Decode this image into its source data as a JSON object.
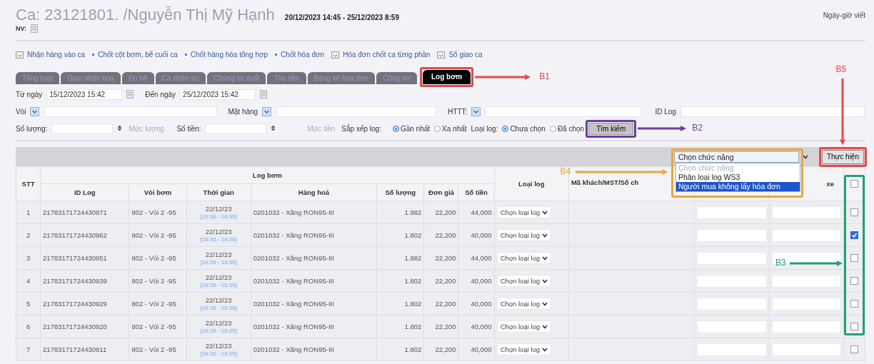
{
  "header": {
    "title": "Ca: 23121801. /Nguyễn Thị Mỹ Hạnh",
    "period": "20/12/2023 14:45 - 25/12/2023 8:59",
    "staff_label": "NV:",
    "right_label": "Ngày-giờ viết"
  },
  "links": [
    {
      "kind": "doc",
      "label": "Nhận hàng vào ca"
    },
    {
      "kind": "bullet",
      "label": "Chốt cột bơm, bể cuối ca"
    },
    {
      "kind": "bullet",
      "label": "Chốt hàng hóa tổng hợp"
    },
    {
      "kind": "bullet",
      "label": "Chốt hóa đơn"
    },
    {
      "kind": "doc",
      "label": "Hóa đơn chốt ca từng phần"
    },
    {
      "kind": "doc",
      "label": "Sổ giao ca"
    }
  ],
  "tabs": [
    {
      "label": "Tổng hợp",
      "selected": false
    },
    {
      "label": "Giao nhận hóa",
      "selected": false
    },
    {
      "label": "Đo bể",
      "selected": false
    },
    {
      "label": "Cá nhân sự",
      "selected": false
    },
    {
      "label": "Chứng từ xuất",
      "selected": false
    },
    {
      "label": "Thu tiền",
      "selected": false
    },
    {
      "label": "Bảng kê hóa đơn",
      "selected": false
    },
    {
      "label": "Công nợ",
      "selected": false
    },
    {
      "label": "Log bơm",
      "selected": true
    }
  ],
  "filters": {
    "from_label": "Từ ngày",
    "from_value": "15/12/2023 15:42",
    "to_label": "Đến ngày",
    "to_value": "25/12/2023 15:42",
    "nozzle_label": "Vòi",
    "product_label": "Mặt hàng",
    "payment_label": "HTTT:",
    "id_label": "ID Log",
    "qty_label": "Số lượng:",
    "qty_placeholder": "Mức lượng",
    "amount_label": "Số tiền:",
    "amount_placeholder": "Mức tiền",
    "sort_label": "Sắp xếp log:",
    "sort_options": [
      {
        "label": "Gần nhất",
        "selected": true
      },
      {
        "label": "Xa nhất",
        "selected": false
      }
    ],
    "type_label": "Loại log:",
    "type_options": [
      {
        "label": "Chưa chọn",
        "selected": true
      },
      {
        "label": "Đã chọn",
        "selected": false
      }
    ],
    "search_button": "Tìm kiếm"
  },
  "toolbar": {
    "function_value": "Chọn chức năng",
    "function_options": [
      {
        "label": "Chọn chức năng",
        "disabled": true,
        "selected": false
      },
      {
        "label": "Phân loại log WS3",
        "disabled": false,
        "selected": false
      },
      {
        "label": "Người mua không lấy hóa đơn",
        "disabled": false,
        "selected": true
      }
    ],
    "run_button": "Thực hiện"
  },
  "table": {
    "select_all_checked": false,
    "stt_header": "STT",
    "group_header": "Log bơm",
    "columns": [
      "ID Log",
      "Vòi bơm",
      "Thời gian",
      "Hàng hoá",
      "Số lượng",
      "Đơn giá",
      "Số tiền"
    ],
    "type_header": "Loại log",
    "customer_header": "Mã khách/MST/Số ch",
    "column_12_header": "xe",
    "rows": [
      {
        "stt": "1",
        "id": "21783171724430971",
        "nozzle": "802 - Vòi 2 -95",
        "date": "22/12/23",
        "time": "[16:36 - 16:36]",
        "product": "0201032 - Xăng RON95-III",
        "qty": "1.982",
        "price": "22,200",
        "amount": "44,000",
        "type": "Chọn loại log",
        "checked": false
      },
      {
        "stt": "2",
        "id": "21783171724430962",
        "nozzle": "802 - Vòi 2 -95",
        "date": "22/12/23",
        "time": "[16:35 - 16:36]",
        "product": "0201032 - Xăng RON95-III",
        "qty": "1.802",
        "price": "22,200",
        "amount": "40,000",
        "type": "Chọn loại log",
        "checked": true
      },
      {
        "stt": "3",
        "id": "21783171724430951",
        "nozzle": "802 - Vòi 2 -95",
        "date": "22/12/23",
        "time": "[16:35 - 16:35]",
        "product": "0201032 - Xăng RON95-III",
        "qty": "1.982",
        "price": "22,200",
        "amount": "44,000",
        "type": "Chọn loại log",
        "checked": false
      },
      {
        "stt": "4",
        "id": "21783171724430939",
        "nozzle": "802 - Vòi 2 -95",
        "date": "22/12/23",
        "time": "[16:35 - 16:35]",
        "product": "0201032 - Xăng RON95-III",
        "qty": "1.802",
        "price": "22,200",
        "amount": "40,000",
        "type": "Chọn loại log",
        "checked": false
      },
      {
        "stt": "5",
        "id": "21783171724430929",
        "nozzle": "802 - Vòi 2 -95",
        "date": "22/12/23",
        "time": "[16:35 - 16:35]",
        "product": "0201032 - Xăng RON95-III",
        "qty": "1.802",
        "price": "22,200",
        "amount": "40,000",
        "type": "Chọn loại log",
        "checked": false
      },
      {
        "stt": "6",
        "id": "21783171724430920",
        "nozzle": "802 - Vòi 2 -95",
        "date": "22/12/23",
        "time": "[16:35 - 16:35]",
        "product": "0201032 - Xăng RON95-III",
        "qty": "1.802",
        "price": "22,200",
        "amount": "40,000",
        "type": "Chọn loại log",
        "checked": false
      },
      {
        "stt": "7",
        "id": "21783171724430911",
        "nozzle": "802 - Vòi 2 -95",
        "date": "22/12/23",
        "time": "[16:35 - 16:35]",
        "product": "0201032 - Xăng RON95-III",
        "qty": "1.802",
        "price": "22,200",
        "amount": "40,000",
        "type": "Chọn loại log",
        "checked": false
      }
    ]
  },
  "annotations": [
    {
      "label": "B1",
      "color": "#e5484d"
    },
    {
      "label": "B2",
      "color": "#6b3fa0"
    },
    {
      "label": "B3",
      "color": "#1fa27a"
    },
    {
      "label": "B4",
      "color": "#eaa63a"
    },
    {
      "label": "B5",
      "color": "#e5484d"
    }
  ]
}
